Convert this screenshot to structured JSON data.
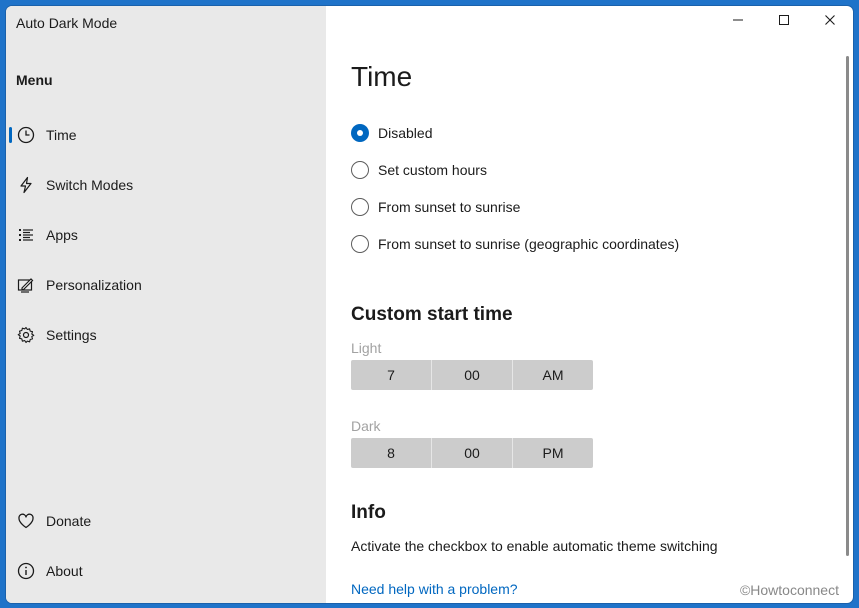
{
  "app_title": "Auto Dark Mode",
  "window_controls": {
    "minimize": "minimize-icon",
    "maximize": "maximize-icon",
    "close": "close-icon"
  },
  "sidebar": {
    "heading": "Menu",
    "items": [
      {
        "label": "Time",
        "icon": "clock-icon",
        "selected": true
      },
      {
        "label": "Switch Modes",
        "icon": "lightning-icon"
      },
      {
        "label": "Apps",
        "icon": "list-icon"
      },
      {
        "label": "Personalization",
        "icon": "personalization-icon"
      },
      {
        "label": "Settings",
        "icon": "gear-icon"
      }
    ],
    "footer_items": [
      {
        "label": "Donate",
        "icon": "heart-icon"
      },
      {
        "label": "About",
        "icon": "info-icon"
      }
    ]
  },
  "main": {
    "title": "Time",
    "options": [
      {
        "label": "Disabled",
        "checked": true
      },
      {
        "label": "Set custom hours",
        "checked": false
      },
      {
        "label": "From sunset to sunrise",
        "checked": false
      },
      {
        "label": "From sunset to sunrise (geographic coordinates)",
        "checked": false
      }
    ],
    "custom_start": {
      "title": "Custom start time",
      "light": {
        "label": "Light",
        "hour": "7",
        "minute": "00",
        "period": "AM"
      },
      "dark": {
        "label": "Dark",
        "hour": "8",
        "minute": "00",
        "period": "PM"
      }
    },
    "info": {
      "title": "Info",
      "text": "Activate the checkbox to enable automatic theme switching",
      "help_link": "Need help with a problem?"
    },
    "watermark": "©Howtoconnect"
  },
  "colors": {
    "accent": "#0067c0",
    "sidebar_bg": "#e9e9e9",
    "picker_bg": "#cccccc"
  }
}
